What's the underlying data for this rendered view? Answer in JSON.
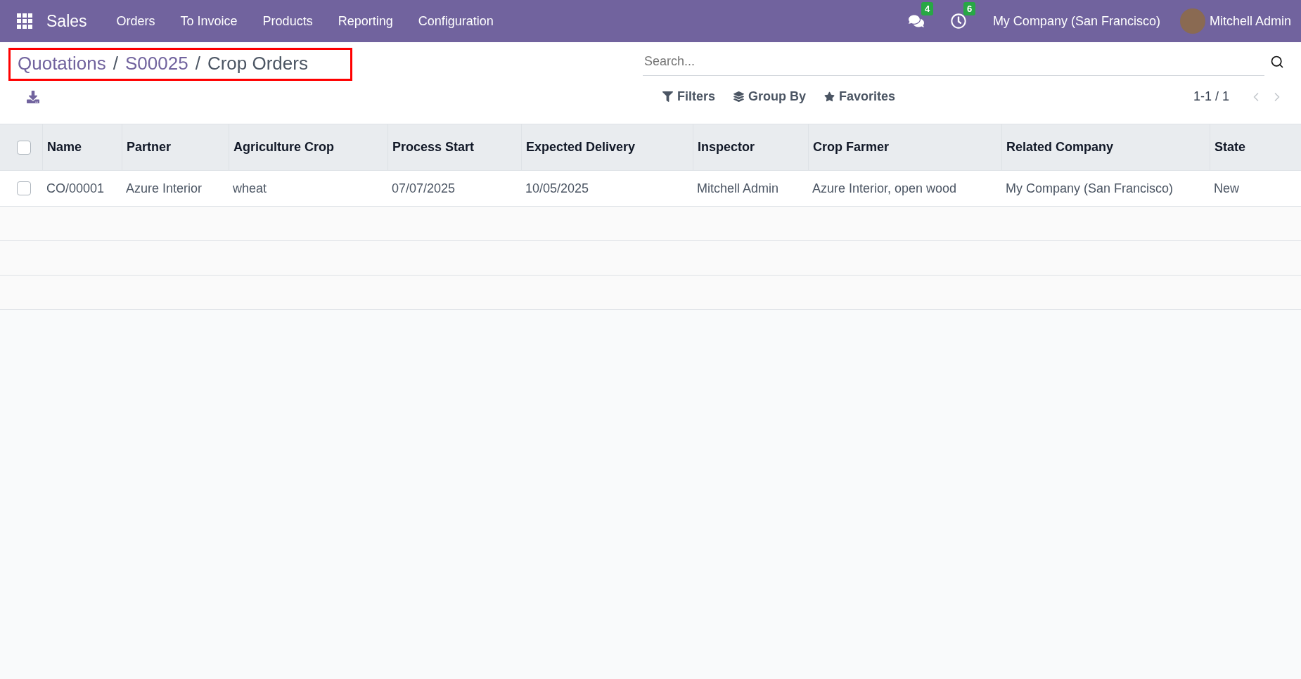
{
  "navbar": {
    "app_name": "Sales",
    "menu": [
      "Orders",
      "To Invoice",
      "Products",
      "Reporting",
      "Configuration"
    ],
    "messages_count": "4",
    "activities_count": "6",
    "company": "My Company (San Francisco)",
    "user": "Mitchell Admin"
  },
  "breadcrumb_separator": "/",
  "breadcrumb": [
    {
      "label": "Quotations",
      "current": false
    },
    {
      "label": "S00025",
      "current": false
    },
    {
      "label": "Crop Orders",
      "current": true
    }
  ],
  "search": {
    "placeholder": "Search..."
  },
  "filters": [
    {
      "kind": "filter",
      "label": "Filters"
    },
    {
      "kind": "group",
      "label": "Group By"
    },
    {
      "kind": "favorite",
      "label": "Favorites"
    }
  ],
  "pager": "1-1 / 1",
  "table": {
    "select_all_checked": false,
    "columns": [
      "Name",
      "Partner",
      "Agriculture Crop",
      "Process Start",
      "Expected Delivery",
      "Inspector",
      "Crop Farmer",
      "Related Company",
      "State"
    ],
    "rows": [
      {
        "selected": false,
        "cells": [
          "CO/00001",
          "Azure Interior",
          "wheat",
          "07/07/2025",
          "10/05/2025",
          "Mitchell Admin",
          "Azure Interior, open wood",
          "My Company (San Francisco)",
          "New"
        ]
      }
    ]
  }
}
